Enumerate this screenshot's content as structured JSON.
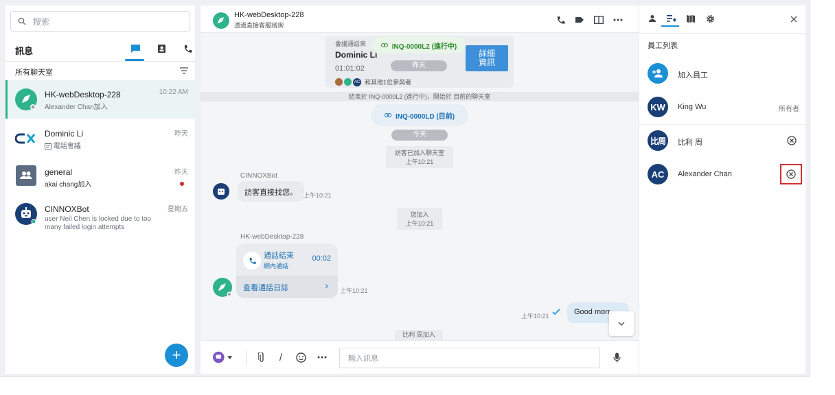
{
  "left": {
    "search_placeholder": "搜索",
    "title": "訊息",
    "filter_label": "所有聊天室",
    "conversations": [
      {
        "name": "HK-webDesktop-228",
        "sub": "Alexander Chan加入",
        "time": "10:22 AM"
      },
      {
        "name": "Dominic Li",
        "sub": "電話會議",
        "time": "昨天"
      },
      {
        "name": "general",
        "sub": "akai chang加入",
        "time": "昨天"
      },
      {
        "name": "CINNOXBot",
        "sub": "user Neil Chen is locked due to too many failed login attempts",
        "time": "星期五"
      }
    ],
    "fab_label": "+"
  },
  "header": {
    "title": "HK-webDesktop-228",
    "subtitle": "透過直接客服諮詢"
  },
  "chat": {
    "card": {
      "label": "會議通話來",
      "name": "Dominic Li",
      "duration": "01:01:02",
      "inquiry_label": "INQ-0000L2 (進行中)",
      "detail_button": "詳細資訊",
      "participants": "和其他1位參與者",
      "date_pill": "昨天",
      "ac_badge": "AC"
    },
    "ended_note": "結束於 INQ-0000L2 (進行中)，開始於 目前的聊天室",
    "current_inquiry": "INQ-0000LD (目前)",
    "today_pill": "今天",
    "visitor_joined": "訪客已加入聊天室",
    "visitor_joined_time": "上午10:21",
    "bot_name": "CINNOXBot",
    "bot_message": "訪客直接找您。",
    "bot_time": "上午10:21",
    "you_joined": "您加入",
    "you_joined_time": "上午10:21",
    "sender_name": "HK-webDesktop-228",
    "call_status": "通話結束",
    "call_type": "網內通話",
    "call_duration": "00:02",
    "call_log_link": "查看通話日誌",
    "call_time": "上午10:21",
    "out_time": "上午10:21",
    "out_message": "Good morr",
    "last_note": "比利 周加入"
  },
  "composer": {
    "placeholder": "輸入訊息"
  },
  "right": {
    "title": "員工列表",
    "add_label": "加入員工",
    "members": [
      {
        "initials": "KW",
        "name": "King Wu",
        "role": "所有者"
      },
      {
        "initials": "比周",
        "name": "比利 周",
        "role": ""
      },
      {
        "initials": "AC",
        "name": "Alexander Chan",
        "role": ""
      }
    ]
  },
  "colors": {
    "accent": "#1a8fd6",
    "green": "#2fb38c",
    "navy": "#1a3e76",
    "highlight": "#d0302f"
  }
}
